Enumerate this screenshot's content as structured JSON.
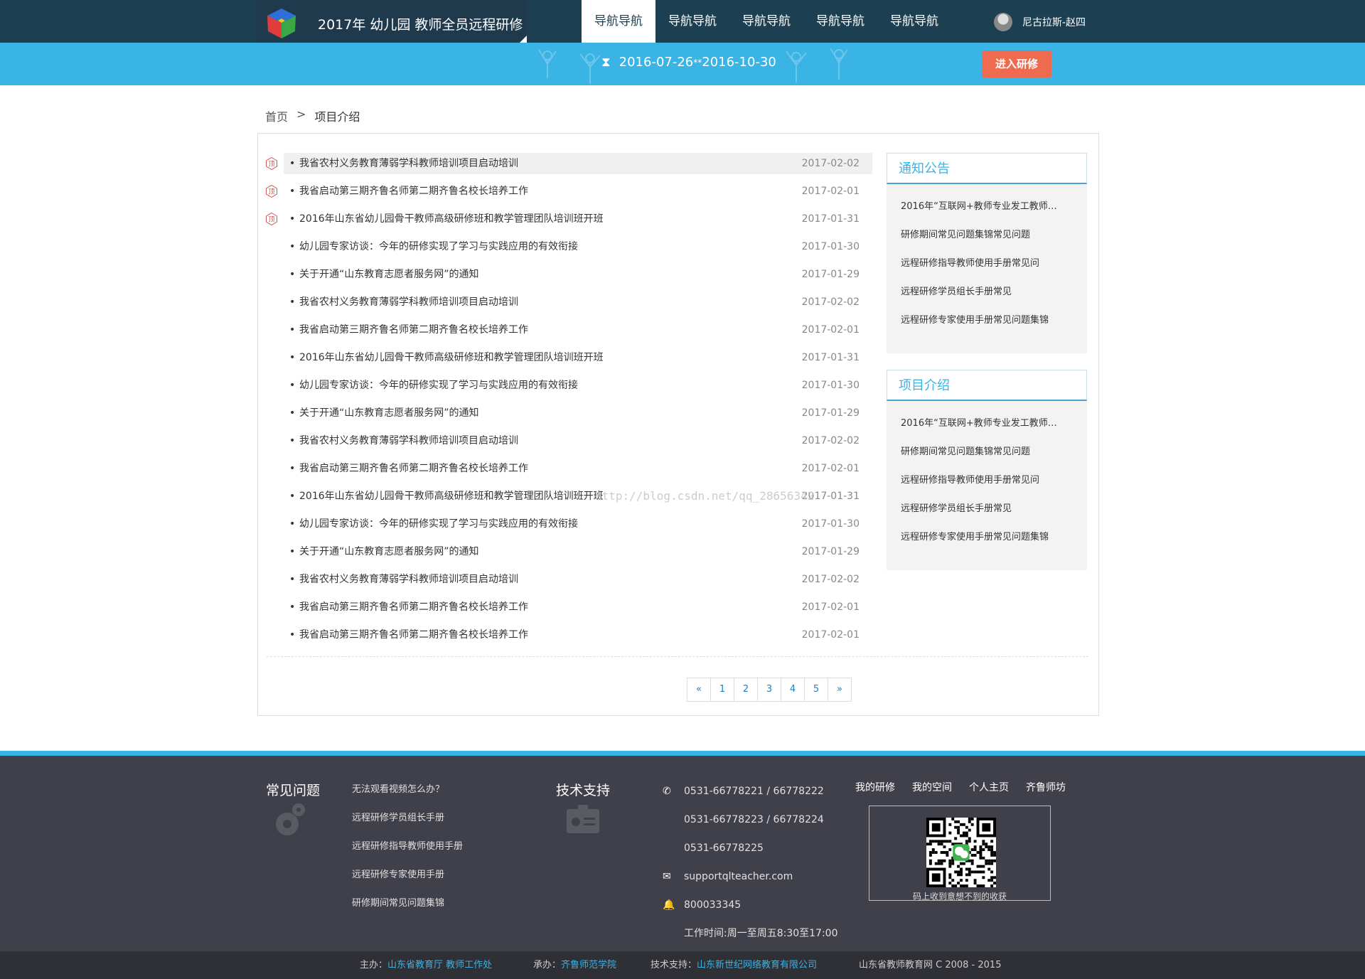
{
  "header": {
    "site_title": "2017年 幼儿园 教师全员远程研修",
    "nav": [
      "导航导航",
      "导航导航",
      "导航导航",
      "导航导航",
      "导航导航"
    ],
    "active_nav_index": 0,
    "user_name": "尼古拉斯-赵四"
  },
  "banner": {
    "start_date": "2016-07-26",
    "separator": "**",
    "end_date": "2016-10-30",
    "enter_button": "进入研修"
  },
  "breadcrumb": {
    "home": "首页",
    "separator": ">",
    "current": "项目介绍"
  },
  "news": [
    {
      "title": "我省农村义务教育薄弱学科教师培训项目启动培训",
      "date": "2017-02-02",
      "badge": "顶",
      "highlight": true
    },
    {
      "title": "我省启动第三期齐鲁名师第二期齐鲁名校长培养工作",
      "date": "2017-02-01",
      "badge": "顶"
    },
    {
      "title": "2016年山东省幼儿园骨干教师高级研修班和教学管理团队培训班开班",
      "date": "2017-01-31",
      "badge": "顶"
    },
    {
      "title": "幼儿园专家访谈：今年的研修实现了学习与实践应用的有效衔接",
      "date": "2017-01-30"
    },
    {
      "title": "关于开通“山东教育志愿者服务网”的通知",
      "date": "2017-01-29"
    },
    {
      "title": "我省农村义务教育薄弱学科教师培训项目启动培训",
      "date": "2017-02-02"
    },
    {
      "title": "我省启动第三期齐鲁名师第二期齐鲁名校长培养工作",
      "date": "2017-02-01"
    },
    {
      "title": "2016年山东省幼儿园骨干教师高级研修班和教学管理团队培训班开班",
      "date": "2017-01-31"
    },
    {
      "title": "幼儿园专家访谈：今年的研修实现了学习与实践应用的有效衔接",
      "date": "2017-01-30"
    },
    {
      "title": "关于开通“山东教育志愿者服务网”的通知",
      "date": "2017-01-29"
    },
    {
      "title": "我省农村义务教育薄弱学科教师培训项目启动培训",
      "date": "2017-02-02"
    },
    {
      "title": "我省启动第三期齐鲁名师第二期齐鲁名校长培养工作",
      "date": "2017-02-01"
    },
    {
      "title": "2016年山东省幼儿园骨干教师高级研修班和教学管理团队培训班开班",
      "date": "2017-01-31"
    },
    {
      "title": "幼儿园专家访谈：今年的研修实现了学习与实践应用的有效衔接",
      "date": "2017-01-30"
    },
    {
      "title": "关于开通“山东教育志愿者服务网”的通知",
      "date": "2017-01-29"
    },
    {
      "title": "我省农村义务教育薄弱学科教师培训项目启动培训",
      "date": "2017-02-02"
    },
    {
      "title": "我省启动第三期齐鲁名师第二期齐鲁名校长培养工作",
      "date": "2017-02-01"
    },
    {
      "title": "我省启动第三期齐鲁名师第二期齐鲁名校长培养工作",
      "date": "2017-02-01"
    }
  ],
  "pagination": [
    "«",
    "1",
    "2",
    "3",
    "4",
    "5",
    "»"
  ],
  "watermark": "http://blog.csdn.net/qq_28656342",
  "sidebar": {
    "notice": {
      "title": "通知公告",
      "items": [
        "2016年“互联网+教师专业发工教师…",
        "研修期间常见问题集锦常见问题",
        "远程研修指导教师使用手册常见问",
        "远程研修学员组长手册常见",
        "远程研修专家使用手册常见问题集锦"
      ]
    },
    "project": {
      "title": "项目介绍",
      "items": [
        "2016年“互联网+教师专业发工教师…",
        "研修期间常见问题集锦常见问题",
        "远程研修指导教师使用手册常见问",
        "远程研修学员组长手册常见",
        "远程研修专家使用手册常见问题集锦"
      ]
    }
  },
  "footer": {
    "faq_title": "常见问题",
    "faq_links": [
      "无法观看视频怎么办？",
      "远程研修学员组长手册",
      "远程研修指导教师使用手册",
      "远程研修专家使用手册",
      "研修期间常见问题集锦"
    ],
    "support_title": "技术支持",
    "contacts": [
      {
        "icon": "phone-icon",
        "text": "0531-66778221 / 66778222"
      },
      {
        "icon": "",
        "text": "0531-66778223 / 66778224"
      },
      {
        "icon": "",
        "text": "0531-66778225"
      },
      {
        "icon": "mail-icon",
        "text": "supportqlteacher.com"
      },
      {
        "icon": "qq-icon",
        "text": "800033345"
      },
      {
        "icon": "",
        "text": "工作时间:周一至周五8:30至17:00"
      }
    ],
    "nav": [
      "我的研修",
      "我的空间",
      "个人主页",
      "齐鲁师坊"
    ],
    "qr_caption": "码上收到意想不到的收获"
  },
  "bottom": {
    "host_label": "主办：",
    "host": "山东省教育厅  教师工作处",
    "organizer_label": "承办：",
    "organizer": "齐鲁师范学院",
    "tech_label": "技术支持：",
    "tech": "山东新世纪网络教育有限公司",
    "copyright": "山东省教师教育网 C 2008 - 2015"
  },
  "colors": {
    "header_bg": "#1d3f52",
    "accent_blue": "#3ab3e5",
    "button_orange": "#ef6b50",
    "footer_bg": "#40404a"
  }
}
